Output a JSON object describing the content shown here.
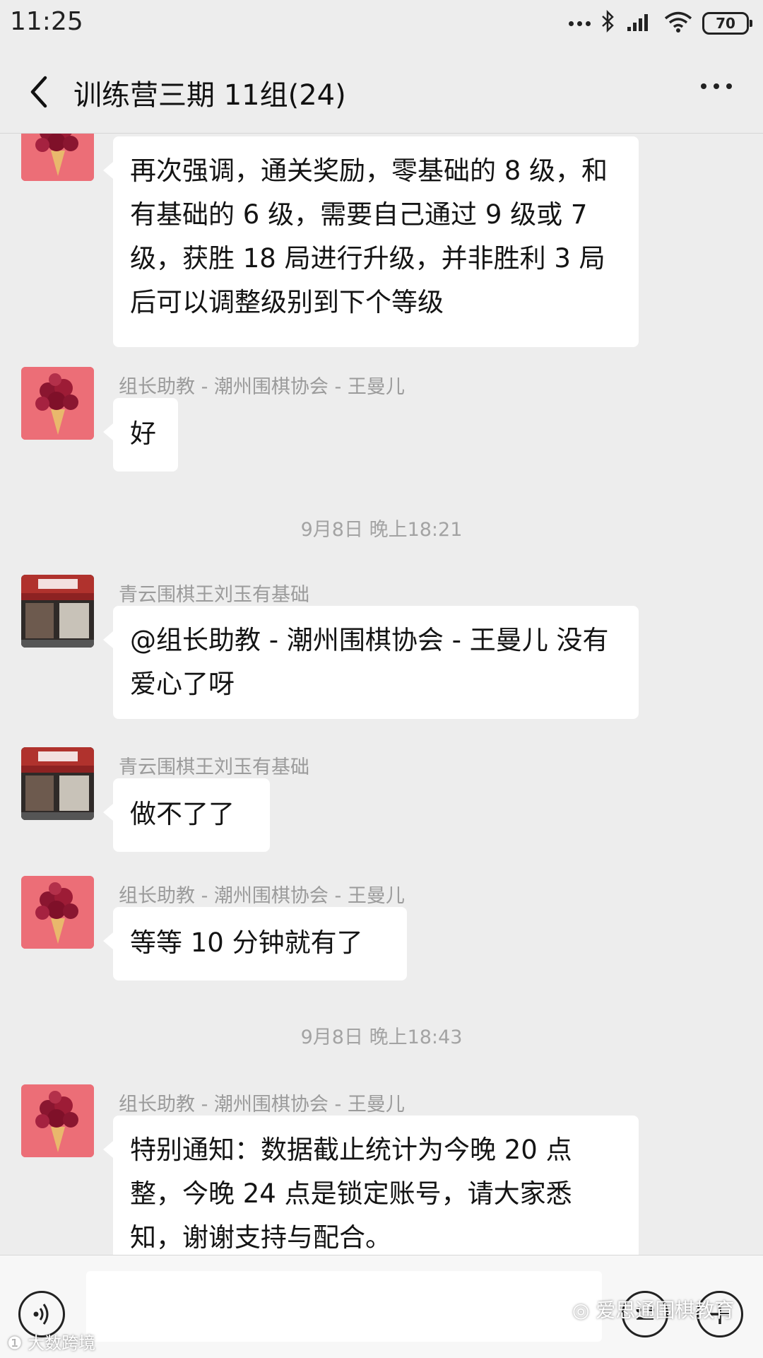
{
  "status_bar": {
    "time": "11:25",
    "battery": "70"
  },
  "nav": {
    "title": "训练营三期 11组(24)"
  },
  "messages": [
    {
      "sender": "",
      "text": "再次强调，通关奖励，零基础的 8 级，和有基础的 6 级，需要自己通过 9 级或 7 级，获胜 18 局进行升级，并非胜利 3 局后可以调整级别到下个等级"
    },
    {
      "sender": "组长助教 - 潮州围棋协会 - 王曼儿",
      "text": "好"
    },
    {
      "sender": "青云围棋王刘玉有基础",
      "text": "@组长助教 - 潮州围棋协会 - 王曼儿  没有爱心了呀"
    },
    {
      "sender": "青云围棋王刘玉有基础",
      "text": "做不了了"
    },
    {
      "sender": "组长助教 - 潮州围棋协会 - 王曼儿",
      "text": "等等 10 分钟就有了"
    },
    {
      "sender": "组长助教 - 潮州围棋协会 - 王曼儿",
      "text": "特别通知：数据截止统计为今晚 20 点整，今晚 24 点是锁定账号，请大家悉知，谢谢支持与配合。"
    }
  ],
  "timestamps": [
    "9月8日 晚上18:21",
    "9月8日 晚上18:43"
  ],
  "watermarks": {
    "right": "爱思通围棋教育",
    "left": "大数跨境"
  }
}
